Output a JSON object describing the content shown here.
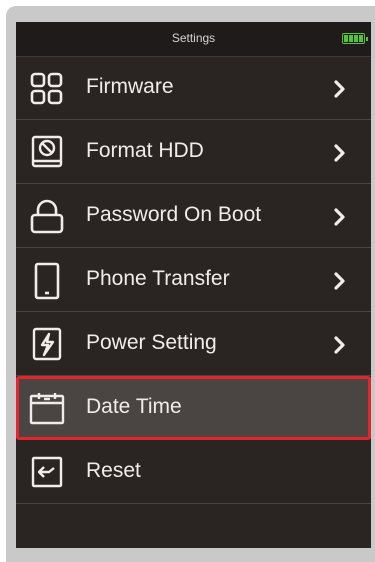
{
  "header": {
    "title": "Settings",
    "battery_icon": "battery-full-icon"
  },
  "menu": {
    "items": [
      {
        "label": "Firmware",
        "icon": "grid-icon",
        "has_arrow": true
      },
      {
        "label": "Format HDD",
        "icon": "disk-format-icon",
        "has_arrow": true
      },
      {
        "label": "Password On Boot",
        "icon": "lock-icon",
        "has_arrow": true
      },
      {
        "label": "Phone Transfer",
        "icon": "phone-icon",
        "has_arrow": true
      },
      {
        "label": "Power Setting",
        "icon": "power-bolt-icon",
        "has_arrow": true
      },
      {
        "label": "Date Time",
        "icon": "calendar-icon",
        "has_arrow": false,
        "selected": true
      },
      {
        "label": "Reset",
        "icon": "reset-icon",
        "has_arrow": false
      }
    ]
  },
  "colors": {
    "background": "#2a2523",
    "selected_background": "#4a4443",
    "highlight_border": "#e3262c",
    "battery": "#56c23a",
    "text": "#f0ece8"
  }
}
